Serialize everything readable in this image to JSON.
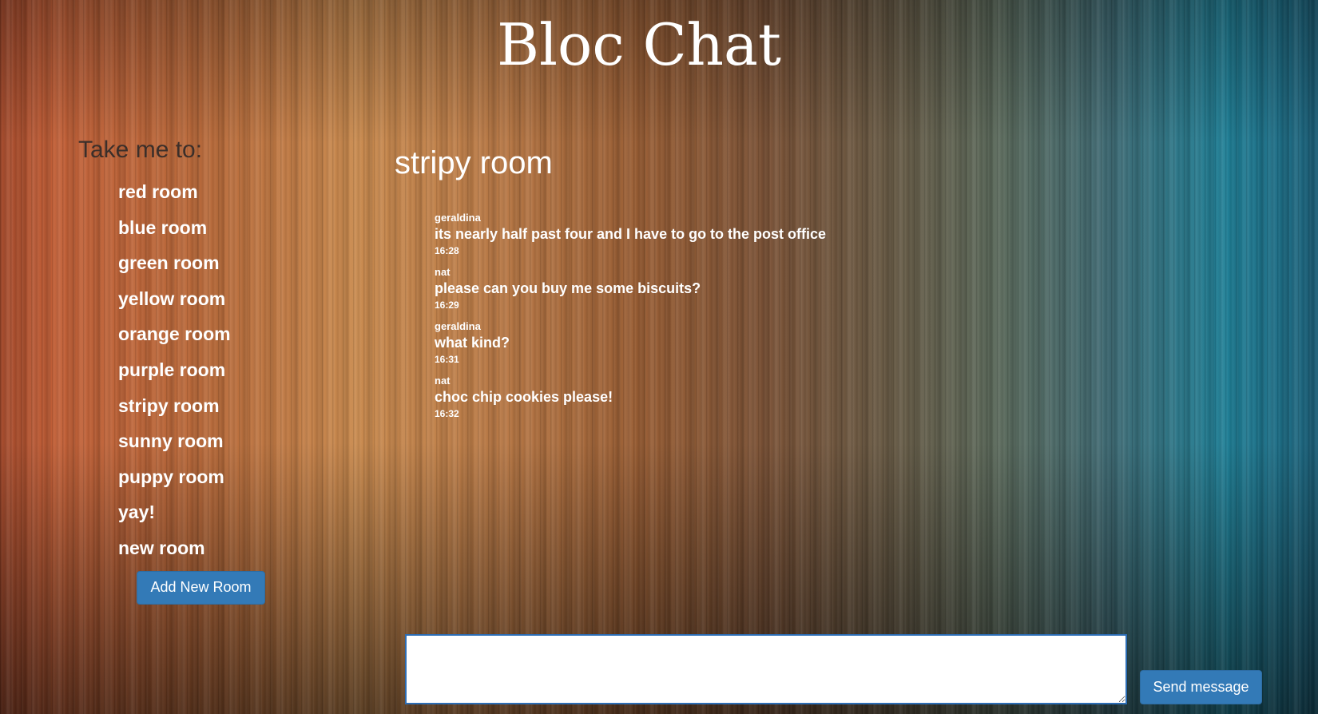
{
  "app": {
    "title": "Bloc Chat"
  },
  "sidebar": {
    "heading": "Take me to:",
    "rooms": [
      "red room",
      "blue room",
      "green room",
      "yellow room",
      "orange room",
      "purple room",
      "stripy room",
      "sunny room",
      "puppy room",
      "yay!",
      "new room"
    ],
    "add_room_label": "Add New Room"
  },
  "main": {
    "room_title": "stripy room",
    "messages": [
      {
        "user": "geraldina",
        "text": "its nearly half past four and I have to go to the post office",
        "time": "16:28"
      },
      {
        "user": "nat",
        "text": "please can you buy me some biscuits?",
        "time": "16:29"
      },
      {
        "user": "geraldina",
        "text": "what kind?",
        "time": "16:31"
      },
      {
        "user": "nat",
        "text": "choc chip cookies please!",
        "time": "16:32"
      }
    ]
  },
  "composer": {
    "value": "",
    "send_label": "Send message"
  }
}
